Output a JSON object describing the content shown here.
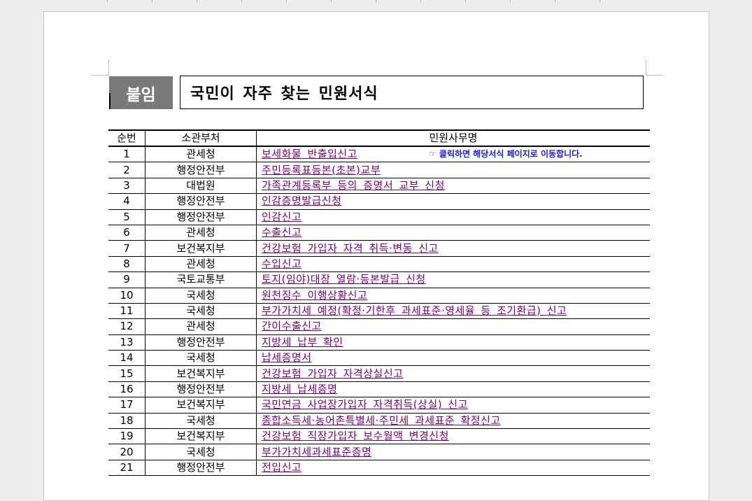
{
  "badge": "붙임",
  "title": "국민이 자주 찾는 민원서식",
  "hint": "☞ 클릭하면 해당서식 페이지로 이동합니다.",
  "table": {
    "headers": [
      "순번",
      "소관부처",
      "민원사무명"
    ],
    "rows": [
      {
        "no": "1",
        "dept": "관세청",
        "name": "보세화물 반출입신고"
      },
      {
        "no": "2",
        "dept": "행정안전부",
        "name": "주민등록표등본(초본)교부"
      },
      {
        "no": "3",
        "dept": "대법원",
        "name": "가족관계등록부 등의 증명서 교부 신청"
      },
      {
        "no": "4",
        "dept": "행정안전부",
        "name": "인감증명발급신청"
      },
      {
        "no": "5",
        "dept": "행정안전부",
        "name": "인감신고"
      },
      {
        "no": "6",
        "dept": "관세청",
        "name": "수출신고"
      },
      {
        "no": "7",
        "dept": "보건복지부",
        "name": "건강보험 가입자 자격 취득·변동 신고"
      },
      {
        "no": "8",
        "dept": "관세청",
        "name": "수입신고"
      },
      {
        "no": "9",
        "dept": "국토교통부",
        "name": "토지(임야)대장 열람·등본발급 신청"
      },
      {
        "no": "10",
        "dept": "국세청",
        "name": "원천징수 이행상황신고"
      },
      {
        "no": "11",
        "dept": "국세청",
        "name": "부가가치세 예정(확정·기한후 과세표준·영세율 등 조기환급) 신고"
      },
      {
        "no": "12",
        "dept": "관세청",
        "name": "간이수출신고"
      },
      {
        "no": "13",
        "dept": "행정안전부",
        "name": "지방세 납부 확인"
      },
      {
        "no": "14",
        "dept": "국세청",
        "name": "납세증명서"
      },
      {
        "no": "15",
        "dept": "보건복지부",
        "name": "건강보험 가입자 자격상실신고"
      },
      {
        "no": "16",
        "dept": "행정안전부",
        "name": "지방세 납세증명"
      },
      {
        "no": "17",
        "dept": "보건복지부",
        "name": "국민연금 사업장가입자 자격취득(상실) 신고"
      },
      {
        "no": "18",
        "dept": "국세청",
        "name": "종합소득세·농어촌특별세·주민세 과세표준 확정신고"
      },
      {
        "no": "19",
        "dept": "보건복지부",
        "name": "건강보험 직장가입자 보수월액 변경신청"
      },
      {
        "no": "20",
        "dept": "국세청",
        "name": "부가가치세과세표준증명"
      },
      {
        "no": "21",
        "dept": "행정안전부",
        "name": "전입신고"
      }
    ]
  }
}
